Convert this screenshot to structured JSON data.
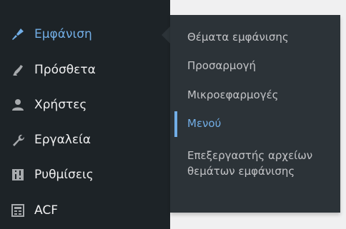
{
  "menu": {
    "items": [
      {
        "label": "Εμφάνιση",
        "icon": "paintbrush-icon",
        "active": true
      },
      {
        "label": "Πρόσθετα",
        "icon": "plugins-icon",
        "active": false
      },
      {
        "label": "Χρήστες",
        "icon": "users-icon",
        "active": false
      },
      {
        "label": "Εργαλεία",
        "icon": "wrench-icon",
        "active": false
      },
      {
        "label": "Ρυθμίσεις",
        "icon": "settings-icon",
        "active": false
      },
      {
        "label": "ACF",
        "icon": "acf-icon",
        "active": false
      }
    ]
  },
  "submenu": {
    "items": [
      {
        "label": "Θέματα εμφάνισης",
        "current": false
      },
      {
        "label": "Προσαρμογή",
        "current": false
      },
      {
        "label": "Μικροεφαρμογές",
        "current": false
      },
      {
        "label": "Μενού",
        "current": true
      },
      {
        "label": "Επεξεργαστής αρχείων θεμάτων εμφάνισης",
        "current": false
      }
    ]
  },
  "colors": {
    "sidebar_bg": "#1d2327",
    "submenu_bg": "#2c3338",
    "text": "#f0f0f1",
    "submenu_text": "#c3c4c7",
    "accent": "#72aee6",
    "page_bg": "#f0f0f1"
  }
}
